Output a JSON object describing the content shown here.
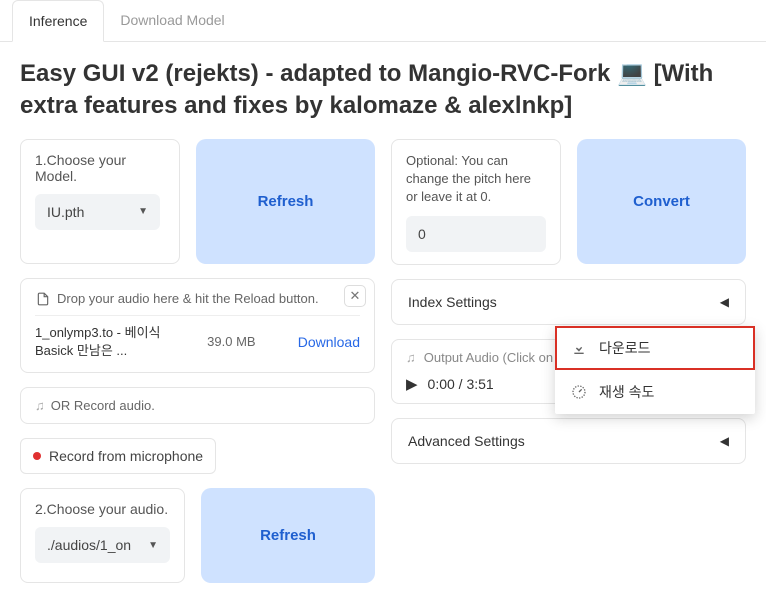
{
  "tabs": {
    "inference": "Inference",
    "download": "Download Model"
  },
  "title": "Easy GUI v2 (rejekts) - adapted to Mangio-RVC-Fork 💻 [With extra features and fixes by kalomaze & alexlnkp]",
  "left": {
    "choose_model_label": "1.Choose your Model.",
    "model_value": "IU.pth",
    "refresh1": "Refresh",
    "drop_label": "Drop your audio here & hit the Reload button.",
    "file_name": "1_onlymp3.to - 베이식 Basick 만남은 ...",
    "file_size": "39.0 MB",
    "download_link": "Download",
    "or_record": "OR Record audio.",
    "record_btn": "Record from microphone",
    "choose_audio_label": "2.Choose your audio.",
    "audio_value": "./audios/1_on",
    "refresh2": "Refresh"
  },
  "right": {
    "optional_label": "Optional: You can change the pitch here or leave it at 0.",
    "pitch_value": "0",
    "convert": "Convert",
    "index_settings": "Index Settings",
    "output_audio_label": "Output Audio (Click on the Three Dots to Download)",
    "time_cur": "0:00",
    "time_sep": " / ",
    "time_dur": "3:51",
    "advanced_settings": "Advanced Settings"
  },
  "menu": {
    "download": "다운로드",
    "speed": "재생 속도"
  }
}
